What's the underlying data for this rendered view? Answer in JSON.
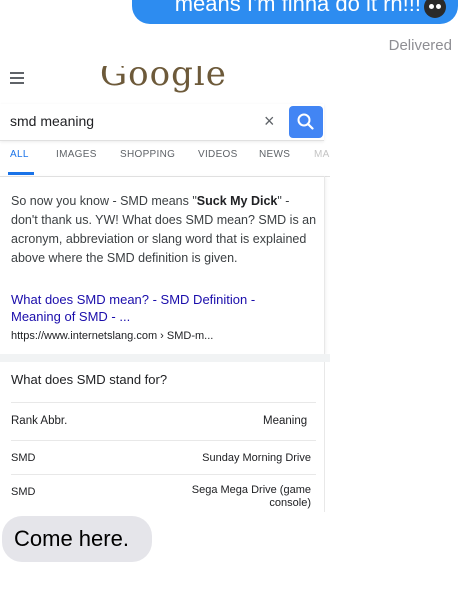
{
  "imessage": {
    "outgoing_text": "means I'm finna do it rn!!!",
    "status": "Delivered",
    "incoming_text": "Come here."
  },
  "google": {
    "logo_text": "Google",
    "query": "smd meaning",
    "clear_symbol": "×",
    "tabs": [
      "ALL",
      "IMAGES",
      "SHOPPING",
      "VIDEOS",
      "NEWS",
      "MA"
    ],
    "snippet": {
      "part1": "So now you know - SMD means \"",
      "bold": "Suck My Dick",
      "part2": "\" - don't thank us. YW! What does SMD mean? SMD is an acronym, abbreviation or slang word that is explained above where the SMD definition is given."
    },
    "result_title": "What does SMD mean? - SMD Definition - Meaning of SMD - ...",
    "result_url": "https://www.internetslang.com › SMD-m...",
    "qa_title": "What does SMD stand for?",
    "table": {
      "headers": [
        "Rank Abbr.",
        "Meaning"
      ],
      "rows": [
        {
          "abbr": "SMD",
          "meaning": "Sunday Morning Drive"
        },
        {
          "abbr": "SMD",
          "meaning": "Sega Mega Drive (game console)"
        }
      ]
    }
  },
  "colors": {
    "imessage_blue": "#2d8cf0",
    "incoming_gray": "#e5e5ea",
    "google_blue": "#4285f4",
    "link": "#1a0dab"
  }
}
